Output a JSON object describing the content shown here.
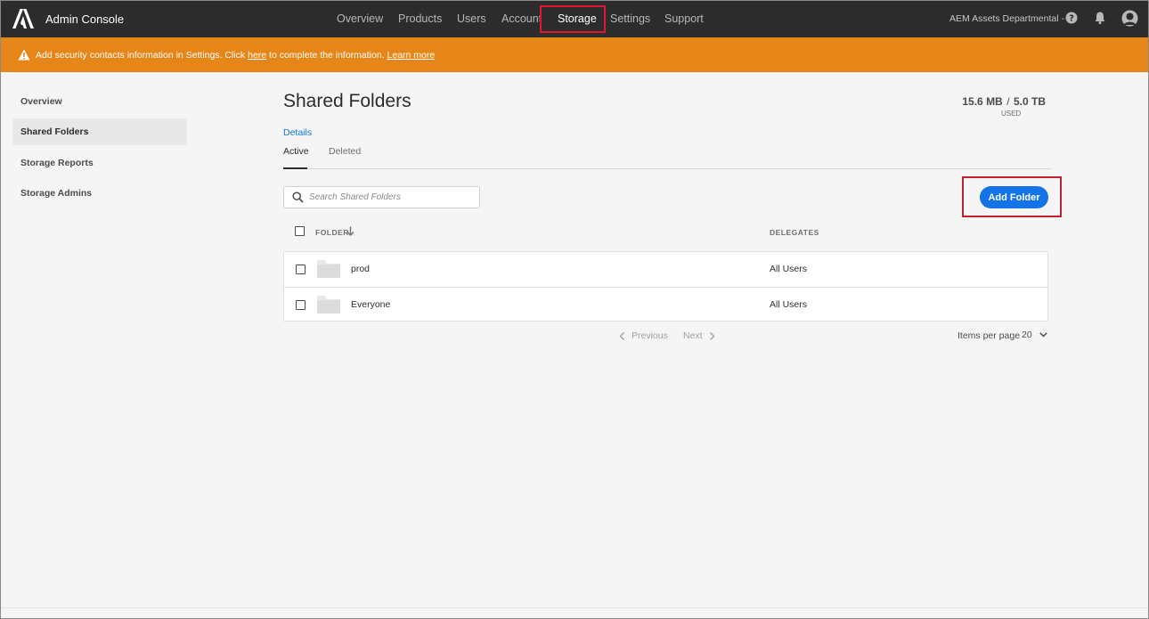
{
  "header": {
    "brand": "Admin Console",
    "nav": [
      "Overview",
      "Products",
      "Users",
      "Account",
      "Storage",
      "Settings",
      "Support"
    ],
    "active_nav": "Storage",
    "org": "AEM Assets Departmental -",
    "icons": [
      "help-icon",
      "bell-icon",
      "avatar-icon"
    ]
  },
  "banner": {
    "prefix": "Add security contacts information in Settings. Click ",
    "here_link": "here",
    "suffix": " to complete the information. ",
    "learn_more": "Learn more",
    "color": "#e68619"
  },
  "sidebar": {
    "items": [
      "Overview",
      "Shared Folders",
      "Storage Reports",
      "Storage Admins"
    ],
    "selected": "Shared Folders"
  },
  "main": {
    "title": "Shared Folders",
    "usage": {
      "used": "15.6 MB",
      "separator": "/",
      "total": "5.0 TB",
      "label": "USED"
    },
    "details_link": "Details",
    "tabs": [
      "Active",
      "Deleted"
    ],
    "active_tab": "Active",
    "search": {
      "placeholder": "Search Shared Folders",
      "value": ""
    },
    "add_button": "Add Folder",
    "table": {
      "headers": {
        "folder": "FOLDER",
        "delegates": "DELEGATES"
      },
      "rows": [
        {
          "name": "prod",
          "delegates": "All Users"
        },
        {
          "name": "Everyone",
          "delegates": "All Users"
        }
      ]
    },
    "pagination": {
      "previous": "Previous",
      "next": "Next",
      "items_per_page_label": "Items per page",
      "items_per_page": "20"
    }
  },
  "colors": {
    "accent": "#1473e6",
    "topbar": "#2c2c2c",
    "highlight": "#e0182d"
  }
}
